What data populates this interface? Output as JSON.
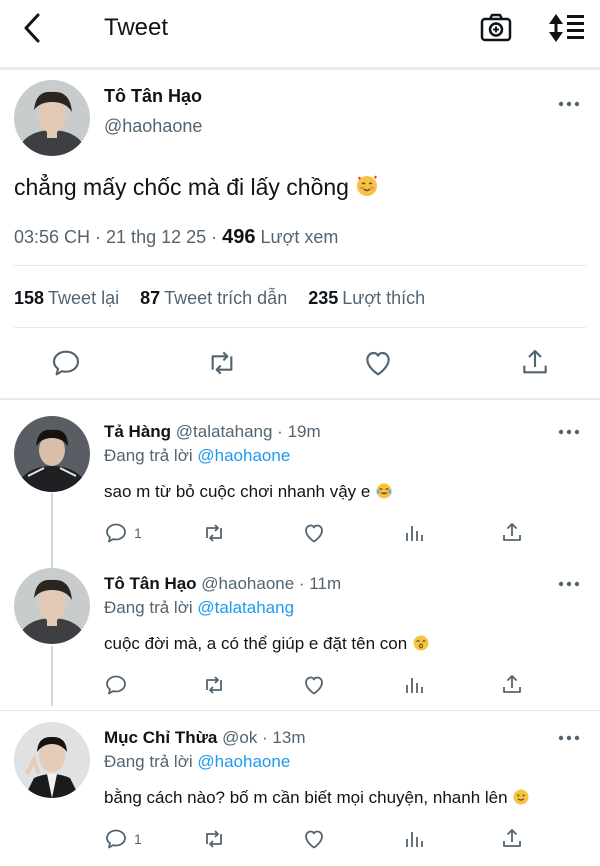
{
  "header": {
    "title": "Tweet",
    "back_icon": "chevron-left-icon",
    "camera_icon": "camera-icon",
    "sort_icon": "sort-icon"
  },
  "tweet": {
    "author_name": "Tô Tân Hạo",
    "author_handle": "@haohaone",
    "text": "chẳng mấy chốc mà đi lấy chồng",
    "emoji": "smiling-face-with-hearts",
    "time": "03:56 CH · 21 thg 12 25 ·",
    "views_count": "496",
    "views_label": "Lượt xem",
    "retweets_count": "158",
    "retweets_label": "Tweet lại",
    "quotes_count": "87",
    "quotes_label": "Tweet trích dẫn",
    "likes_count": "235",
    "likes_label": "Lượt thích"
  },
  "replies": [
    {
      "name": "Tả Hàng",
      "meta": "@talatahang · 19m",
      "replying_label": "Đang trả lời",
      "replying_to": "@haohaone",
      "text": "sao m từ bỏ cuộc chơi nhanh vậy e",
      "emoji": "tears-of-joy",
      "reply_count": "1"
    },
    {
      "name": "Tô Tân Hạo",
      "meta": "@haohaone · 11m",
      "replying_label": "Đang trả lời",
      "replying_to": "@talatahang",
      "text": "cuộc đời mà, a có thể giúp e đặt tên con",
      "emoji": "kissing-face",
      "reply_count": ""
    },
    {
      "name": "Mục Chỉ Thừa",
      "meta": "@ok · 13m",
      "replying_label": "Đang trả lời",
      "replying_to": "@haohaone",
      "text": "bằng cách nào? bố m cần biết mọi chuyện, nhanh lên",
      "emoji": "slightly-smiling-face",
      "reply_count": "1"
    }
  ],
  "colors": {
    "accent": "#1d9bf0",
    "secondary_text": "#536471",
    "divider": "#e7e9ea"
  }
}
